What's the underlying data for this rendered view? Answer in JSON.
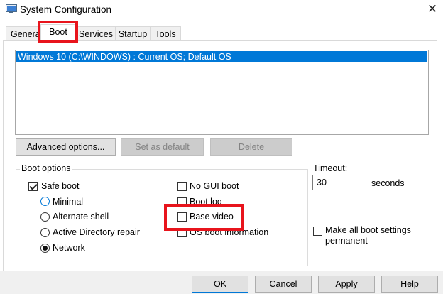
{
  "window": {
    "title": "System Configuration",
    "close_glyph": "✕"
  },
  "tabs": [
    {
      "label": "General",
      "display": "Genera",
      "active": false
    },
    {
      "label": "Boot",
      "active": true
    },
    {
      "label": "Services",
      "active": false
    },
    {
      "label": "Startup",
      "active": false
    },
    {
      "label": "Tools",
      "active": false
    }
  ],
  "boot_list": {
    "items": [
      "Windows 10 (C:\\WINDOWS) : Current OS; Default OS"
    ],
    "selected_index": 0
  },
  "boot_buttons": {
    "advanced": "Advanced options...",
    "set_default": "Set as default",
    "delete": "Delete"
  },
  "boot_options": {
    "group_label": "Boot options",
    "safe_boot": {
      "label": "Safe boot",
      "checked": true
    },
    "radios": {
      "minimal": {
        "label": "Minimal",
        "selected": false
      },
      "alternate_shell": {
        "label": "Alternate shell",
        "selected": false
      },
      "ad_repair": {
        "label": "Active Directory repair",
        "selected": false
      },
      "network": {
        "label": "Network",
        "selected": true
      }
    },
    "no_gui_boot": {
      "label": "No GUI boot",
      "checked": false
    },
    "boot_log": {
      "label": "Boot log",
      "checked": false
    },
    "base_video": {
      "label": "Base video",
      "checked": false
    },
    "os_boot_info": {
      "label": "OS boot information",
      "checked": false
    }
  },
  "timeout": {
    "label": "Timeout:",
    "value": "30",
    "unit": "seconds"
  },
  "permanent": {
    "label_line1": "Make all boot settings",
    "label_line2": "permanent",
    "checked": false
  },
  "dialog_buttons": {
    "ok": "OK",
    "cancel": "Cancel",
    "apply": "Apply",
    "help": "Help"
  },
  "highlight_color": "#e8141c",
  "accent_color": "#0078d7",
  "icons": {
    "app": "system-config-icon",
    "close": "close-icon"
  }
}
